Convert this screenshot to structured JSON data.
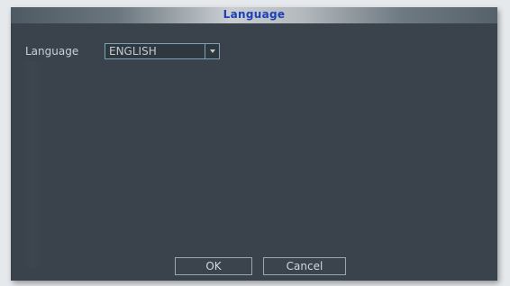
{
  "dialog": {
    "title": "Language",
    "language_label": "Language",
    "language_value": "ENGLISH",
    "ok_label": "OK",
    "cancel_label": "Cancel"
  },
  "colors": {
    "title_text": "#1e3fb8",
    "panel_bg": "#3a434b",
    "select_border": "#7aa3b8"
  },
  "icons": {
    "dropdown": "chevron-down-icon"
  }
}
